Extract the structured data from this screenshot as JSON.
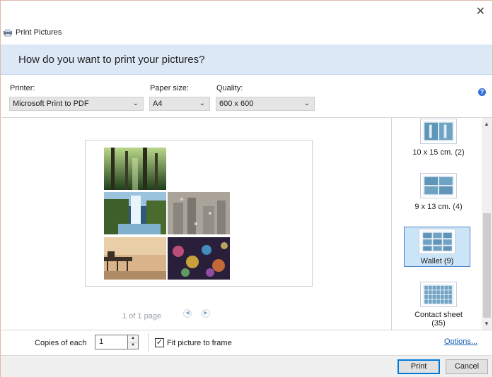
{
  "window": {
    "title": "Print Pictures",
    "close_glyph": "✕"
  },
  "banner": {
    "question": "How do you want to print your pictures?"
  },
  "printer": {
    "label": "Printer:",
    "value": "Microsoft Print to PDF"
  },
  "paper_size": {
    "label": "Paper size:",
    "value": "A4"
  },
  "quality": {
    "label": "Quality:",
    "value": "600 x 600"
  },
  "help_glyph": "?",
  "preview": {
    "page_info": "1 of 1 page",
    "prev_glyph": "◀",
    "next_glyph": "▶"
  },
  "layouts": [
    {
      "label": "10 x 15 cm. (2)",
      "selected": false
    },
    {
      "label": "9 x 13 cm. (4)",
      "selected": false
    },
    {
      "label": "Wallet (9)",
      "selected": true
    },
    {
      "label": "Contact sheet",
      "label2": "(35)",
      "selected": false
    }
  ],
  "copies": {
    "label": "Copies of each",
    "value": "1"
  },
  "fit": {
    "label": "Fit picture to frame",
    "checked": true
  },
  "options_link": "Options...",
  "buttons": {
    "print": "Print",
    "cancel": "Cancel"
  },
  "colors": {
    "banner": "#dce8f5",
    "accent": "#0078d7",
    "selected": "#cce4f7"
  },
  "icons": [
    "printer-icon",
    "close-icon",
    "help-icon",
    "chevron-down-icon",
    "prev-page-icon",
    "next-page-icon",
    "scroll-up-icon",
    "scroll-down-icon",
    "checkmark-icon"
  ]
}
